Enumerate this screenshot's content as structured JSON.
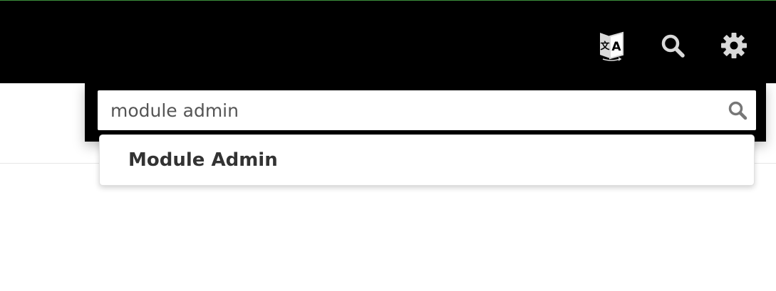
{
  "topbar": {
    "icons": {
      "translate": "translate-icon",
      "search": "search-icon",
      "settings": "gear-icon"
    },
    "colors": {
      "background": "#000000",
      "icon": "#d9d9d9",
      "accent_line": "#3c8f3c"
    }
  },
  "search": {
    "value": "module admin",
    "placeholder": "",
    "icon": "search-icon"
  },
  "suggestions": [
    {
      "label": "Module Admin"
    }
  ]
}
